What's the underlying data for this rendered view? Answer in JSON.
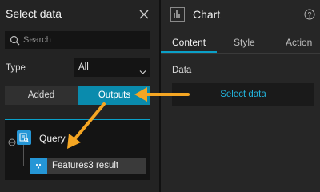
{
  "left_panel": {
    "title": "Select data",
    "search": {
      "placeholder": "Search",
      "value": ""
    },
    "type_filter": {
      "label": "Type",
      "selected": "All"
    },
    "segments": [
      {
        "label": "Added",
        "active": false
      },
      {
        "label": "Outputs",
        "active": true
      }
    ],
    "tree": {
      "node": {
        "label": "Query",
        "icon": "query-widget-icon",
        "expanded": true
      },
      "child": {
        "label": "Features3 result",
        "icon": "result-dots-icon"
      }
    }
  },
  "right_panel": {
    "title": "Chart",
    "tabs": [
      {
        "label": "Content",
        "active": true
      },
      {
        "label": "Style",
        "active": false
      },
      {
        "label": "Action",
        "active": false
      }
    ],
    "data_section": {
      "label": "Data",
      "button_label": "Select data"
    }
  },
  "colors": {
    "accent": "#0a8bad",
    "link": "#23b4dd",
    "annotation_arrow": "#f5a623"
  }
}
